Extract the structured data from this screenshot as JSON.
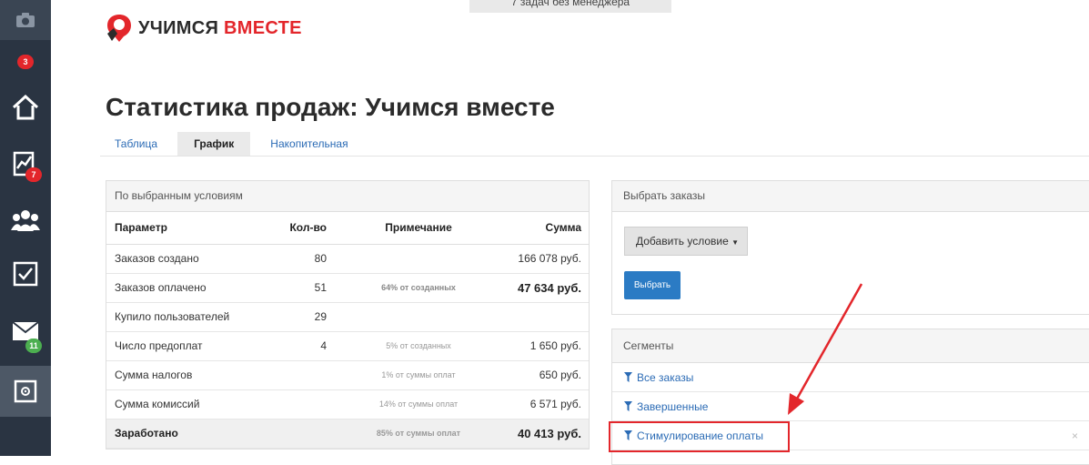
{
  "sidebar": {
    "items": [
      {
        "icon": "camera-icon"
      },
      {
        "icon": "notification-badge",
        "badge": "3"
      },
      {
        "icon": "home-icon"
      },
      {
        "icon": "chart-icon",
        "badge": "7"
      },
      {
        "icon": "users-icon"
      },
      {
        "icon": "checkbox-icon"
      },
      {
        "icon": "mail-icon",
        "badge": "11"
      },
      {
        "icon": "safe-icon"
      }
    ]
  },
  "header": {
    "logo_dark": "УЧИМСЯ",
    "logo_red": "ВМЕСТЕ",
    "notice": "7 задач без менеджера"
  },
  "page_title": "Статистика продаж: Учимся вместе",
  "tabs": [
    {
      "label": "Таблица",
      "active": false
    },
    {
      "label": "График",
      "active": true
    },
    {
      "label": "Накопительная",
      "active": false
    }
  ],
  "stats": {
    "heading": "По выбранным условиям",
    "columns": [
      "Параметр",
      "Кол-во",
      "Примечание",
      "Сумма"
    ],
    "rows": [
      {
        "param": "Заказов создано",
        "count": "80",
        "note": "",
        "sum": "166 078 руб."
      },
      {
        "param": "Заказов оплачено",
        "count": "51",
        "note": "64% от созданных",
        "sum": "47 634 руб."
      },
      {
        "param": "Купило пользователей",
        "count": "29",
        "note": "",
        "sum": ""
      },
      {
        "param": "Число предоплат",
        "count": "4",
        "note": "5% от созданных",
        "sum": "1 650 руб."
      },
      {
        "param": "Сумма налогов",
        "count": "",
        "note": "1% от суммы оплат",
        "sum": "650 руб."
      },
      {
        "param": "Сумма комиссий",
        "count": "",
        "note": "14% от суммы оплат",
        "sum": "6 571 руб."
      }
    ],
    "total": {
      "param": "Заработано",
      "count": "",
      "note": "85% от суммы оплат",
      "sum": "40 413 руб."
    }
  },
  "orders": {
    "heading": "Выбрать заказы",
    "add_condition": "Добавить условие",
    "choose": "Выбрать"
  },
  "segments": {
    "heading": "Сегменты",
    "items": [
      "Все заказы",
      "Завершенные",
      "Стимулирование оплаты"
    ],
    "close": "×"
  },
  "colors": {
    "sidebar": "#2a3442",
    "accent_red": "#e3262b",
    "link_blue": "#2b6bb5",
    "button_blue": "#2b7bc4",
    "badge_green": "#4caf50"
  }
}
